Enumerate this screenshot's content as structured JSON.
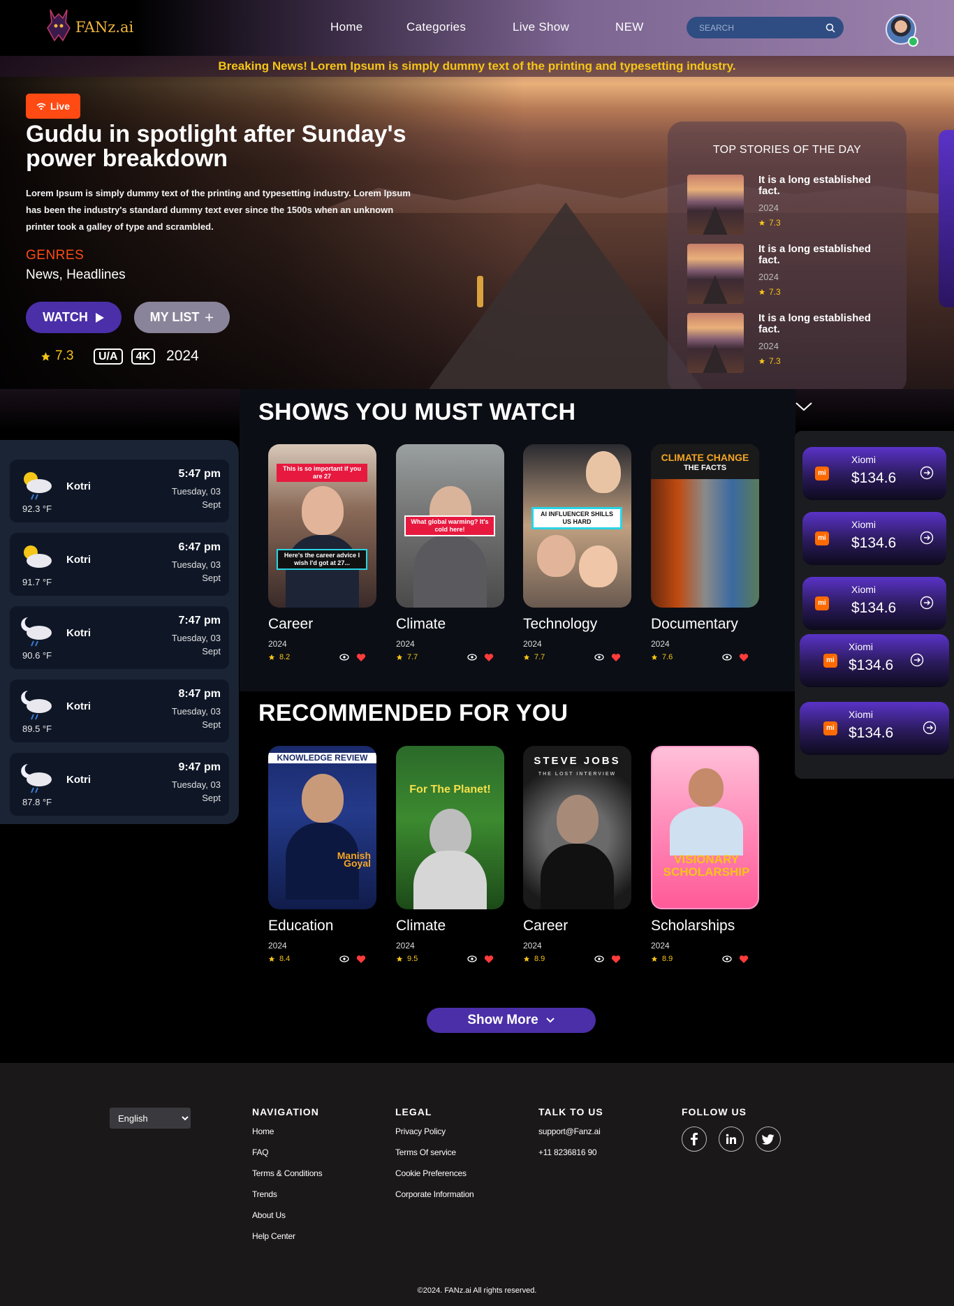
{
  "header": {
    "logo_text": "FANz.ai",
    "nav": [
      "Home",
      "Categories",
      "Live Show",
      "NEW"
    ],
    "search_placeholder": "SEARCH"
  },
  "ticker": "Breaking News! Lorem Ipsum is simply dummy text of the printing and typesetting industry.",
  "hero": {
    "live_label": "Live",
    "title": "Guddu in spotlight after Sunday's power breakdown",
    "description": "Lorem Ipsum is simply dummy text of the printing and typesetting industry. Lorem Ipsum has been the industry's standard dummy text ever since the 1500s when an unknown printer took a galley of type and scrambled.",
    "genres_label": "GENRES",
    "genres_value": "News, Headlines",
    "watch_label": "WATCH",
    "mylist_label": "MY LIST",
    "rating": "7.3",
    "tags": [
      "U/A",
      "4K"
    ],
    "year": "2024"
  },
  "top_stories": {
    "title": "TOP STORIES OF THE DAY",
    "items": [
      {
        "title": "It is a long established fact.",
        "year": "2024",
        "rating": "7.3"
      },
      {
        "title": "It is a long established fact.",
        "year": "2024",
        "rating": "7.3"
      },
      {
        "title": "It is a long established fact.",
        "year": "2024",
        "rating": "7.3"
      }
    ]
  },
  "shows": {
    "title": "SHOWS YOU MUST WATCH",
    "items": [
      {
        "label": "Career",
        "year": "2024",
        "rating": "8.2",
        "caption_top": "This is so important if you are 27",
        "caption_bottom": "Here's the career advice I wish I'd got at 27..."
      },
      {
        "label": "Climate",
        "year": "2024",
        "rating": "7.7",
        "caption_top": "What global warming? It's cold here!"
      },
      {
        "label": "Technology",
        "year": "2024",
        "rating": "7.7",
        "caption_top": "AI INFLUENCER SHILLS US HARD"
      },
      {
        "label": "Documentary",
        "year": "2024",
        "rating": "7.6",
        "caption_top": "CLIMATE CHANGE",
        "caption_bottom": "THE FACTS"
      }
    ]
  },
  "recommended": {
    "title": "RECOMMENDED FOR YOU",
    "items": [
      {
        "label": "Education",
        "year": "2024",
        "rating": "8.4",
        "caption_top": "KNOWLEDGE REVIEW",
        "caption_bottom": "Manish Goyal"
      },
      {
        "label": "Climate",
        "year": "2024",
        "rating": "9.5",
        "caption_top": "For The Planet!"
      },
      {
        "label": "Career",
        "year": "2024",
        "rating": "8.9",
        "caption_top": "STEVE JOBS",
        "caption_bottom": "THE LOST INTERVIEW"
      },
      {
        "label": "Scholarships",
        "year": "2024",
        "rating": "8.9",
        "caption_top": "VISIONARY SCHOLARSHIP"
      }
    ]
  },
  "weather": [
    {
      "city": "Kotri",
      "time": "5:47 pm",
      "day": "Tuesday, 03",
      "month": "Sept",
      "temp": "92.3 °F",
      "icon": "sun-cloud-rain-icon"
    },
    {
      "city": "Kotri",
      "time": "6:47 pm",
      "day": "Tuesday, 03",
      "month": "Sept",
      "temp": "91.7 °F",
      "icon": "sun-cloud-icon"
    },
    {
      "city": "Kotri",
      "time": "7:47 pm",
      "day": "Tuesday, 03",
      "month": "Sept",
      "temp": "90.6 °F",
      "icon": "moon-cloud-rain-icon"
    },
    {
      "city": "Kotri",
      "time": "8:47 pm",
      "day": "Tuesday, 03",
      "month": "Sept",
      "temp": "89.5 °F",
      "icon": "moon-cloud-rain-icon"
    },
    {
      "city": "Kotri",
      "time": "9:47 pm",
      "day": "Tuesday, 03",
      "month": "Sept",
      "temp": "87.8 °F",
      "icon": "moon-cloud-rain-icon"
    }
  ],
  "prices": [
    {
      "brand": "Xiomi",
      "value": "$134.6"
    },
    {
      "brand": "Xiomi",
      "value": "$134.6"
    },
    {
      "brand": "Xiomi",
      "value": "$134.6"
    },
    {
      "brand": "Xiomi",
      "value": "$134.6"
    },
    {
      "brand": "Xiomi",
      "value": "$134.6"
    }
  ],
  "show_more": "Show More",
  "footer": {
    "language": "English",
    "navigation": {
      "title": "NAVIGATION",
      "links": [
        "Home",
        "FAQ",
        "Terms & Conditions",
        "Trends",
        "About Us",
        "Help Center"
      ]
    },
    "legal": {
      "title": "LEGAL",
      "links": [
        "Privacy Policy",
        "Terms Of service",
        "Cookie Preferences",
        "Corporate Information"
      ]
    },
    "talk": {
      "title": "TALK TO US",
      "links": [
        "support@Fanz.ai",
        "+11 8236816 90"
      ]
    },
    "follow": {
      "title": "FOLLOW US"
    },
    "copyright": "©2024. FANz.ai All rights reserved."
  },
  "colors": {
    "accent": "#4a2fa8",
    "live": "#ff4a14",
    "gold": "#f5c518"
  }
}
